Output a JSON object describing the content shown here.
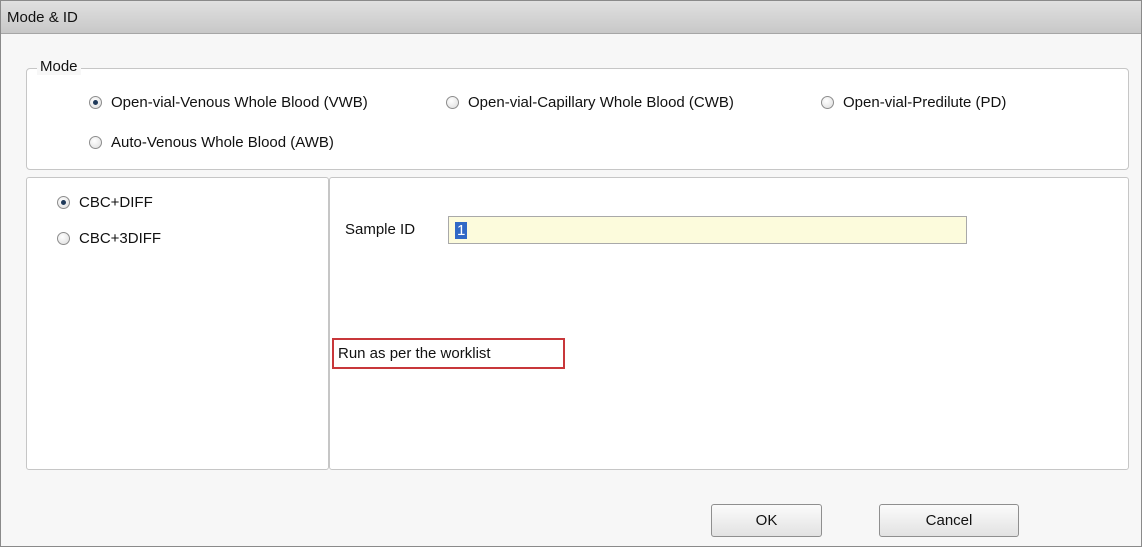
{
  "window": {
    "title": "Mode & ID"
  },
  "mode": {
    "legend": "Mode",
    "options": [
      {
        "label": "Open-vial-Venous Whole Blood (VWB)",
        "checked": true
      },
      {
        "label": "Open-vial-Capillary Whole Blood (CWB)",
        "checked": false
      },
      {
        "label": "Open-vial-Predilute (PD)",
        "checked": false
      },
      {
        "label": "Auto-Venous Whole Blood (AWB)",
        "checked": false
      }
    ]
  },
  "analysis": {
    "options": [
      {
        "label": "CBC+DIFF",
        "checked": true
      },
      {
        "label": "CBC+3DIFF",
        "checked": false
      }
    ]
  },
  "sample": {
    "label": "Sample ID",
    "value": "1"
  },
  "worklist": {
    "label": "Run as per the worklist"
  },
  "buttons": {
    "ok": "OK",
    "cancel": "Cancel"
  }
}
